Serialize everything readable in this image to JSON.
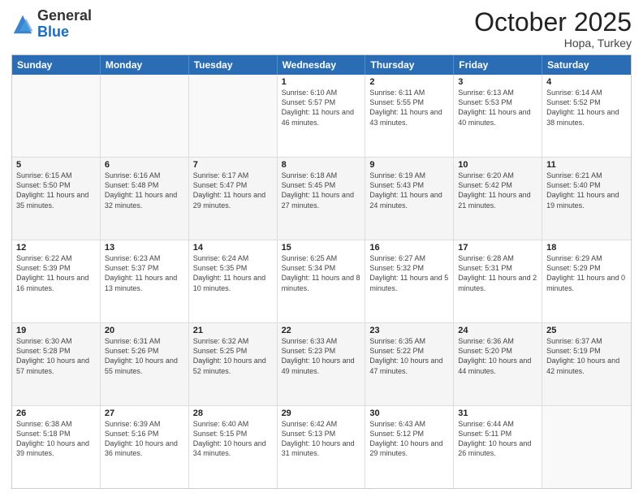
{
  "header": {
    "logo_general": "General",
    "logo_blue": "Blue",
    "month_title": "October 2025",
    "subtitle": "Hopa, Turkey"
  },
  "days_of_week": [
    "Sunday",
    "Monday",
    "Tuesday",
    "Wednesday",
    "Thursday",
    "Friday",
    "Saturday"
  ],
  "rows": [
    {
      "cells": [
        {
          "day": "",
          "info": ""
        },
        {
          "day": "",
          "info": ""
        },
        {
          "day": "",
          "info": ""
        },
        {
          "day": "1",
          "info": "Sunrise: 6:10 AM\nSunset: 5:57 PM\nDaylight: 11 hours and 46 minutes."
        },
        {
          "day": "2",
          "info": "Sunrise: 6:11 AM\nSunset: 5:55 PM\nDaylight: 11 hours and 43 minutes."
        },
        {
          "day": "3",
          "info": "Sunrise: 6:13 AM\nSunset: 5:53 PM\nDaylight: 11 hours and 40 minutes."
        },
        {
          "day": "4",
          "info": "Sunrise: 6:14 AM\nSunset: 5:52 PM\nDaylight: 11 hours and 38 minutes."
        }
      ]
    },
    {
      "cells": [
        {
          "day": "5",
          "info": "Sunrise: 6:15 AM\nSunset: 5:50 PM\nDaylight: 11 hours and 35 minutes."
        },
        {
          "day": "6",
          "info": "Sunrise: 6:16 AM\nSunset: 5:48 PM\nDaylight: 11 hours and 32 minutes."
        },
        {
          "day": "7",
          "info": "Sunrise: 6:17 AM\nSunset: 5:47 PM\nDaylight: 11 hours and 29 minutes."
        },
        {
          "day": "8",
          "info": "Sunrise: 6:18 AM\nSunset: 5:45 PM\nDaylight: 11 hours and 27 minutes."
        },
        {
          "day": "9",
          "info": "Sunrise: 6:19 AM\nSunset: 5:43 PM\nDaylight: 11 hours and 24 minutes."
        },
        {
          "day": "10",
          "info": "Sunrise: 6:20 AM\nSunset: 5:42 PM\nDaylight: 11 hours and 21 minutes."
        },
        {
          "day": "11",
          "info": "Sunrise: 6:21 AM\nSunset: 5:40 PM\nDaylight: 11 hours and 19 minutes."
        }
      ]
    },
    {
      "cells": [
        {
          "day": "12",
          "info": "Sunrise: 6:22 AM\nSunset: 5:39 PM\nDaylight: 11 hours and 16 minutes."
        },
        {
          "day": "13",
          "info": "Sunrise: 6:23 AM\nSunset: 5:37 PM\nDaylight: 11 hours and 13 minutes."
        },
        {
          "day": "14",
          "info": "Sunrise: 6:24 AM\nSunset: 5:35 PM\nDaylight: 11 hours and 10 minutes."
        },
        {
          "day": "15",
          "info": "Sunrise: 6:25 AM\nSunset: 5:34 PM\nDaylight: 11 hours and 8 minutes."
        },
        {
          "day": "16",
          "info": "Sunrise: 6:27 AM\nSunset: 5:32 PM\nDaylight: 11 hours and 5 minutes."
        },
        {
          "day": "17",
          "info": "Sunrise: 6:28 AM\nSunset: 5:31 PM\nDaylight: 11 hours and 2 minutes."
        },
        {
          "day": "18",
          "info": "Sunrise: 6:29 AM\nSunset: 5:29 PM\nDaylight: 11 hours and 0 minutes."
        }
      ]
    },
    {
      "cells": [
        {
          "day": "19",
          "info": "Sunrise: 6:30 AM\nSunset: 5:28 PM\nDaylight: 10 hours and 57 minutes."
        },
        {
          "day": "20",
          "info": "Sunrise: 6:31 AM\nSunset: 5:26 PM\nDaylight: 10 hours and 55 minutes."
        },
        {
          "day": "21",
          "info": "Sunrise: 6:32 AM\nSunset: 5:25 PM\nDaylight: 10 hours and 52 minutes."
        },
        {
          "day": "22",
          "info": "Sunrise: 6:33 AM\nSunset: 5:23 PM\nDaylight: 10 hours and 49 minutes."
        },
        {
          "day": "23",
          "info": "Sunrise: 6:35 AM\nSunset: 5:22 PM\nDaylight: 10 hours and 47 minutes."
        },
        {
          "day": "24",
          "info": "Sunrise: 6:36 AM\nSunset: 5:20 PM\nDaylight: 10 hours and 44 minutes."
        },
        {
          "day": "25",
          "info": "Sunrise: 6:37 AM\nSunset: 5:19 PM\nDaylight: 10 hours and 42 minutes."
        }
      ]
    },
    {
      "cells": [
        {
          "day": "26",
          "info": "Sunrise: 6:38 AM\nSunset: 5:18 PM\nDaylight: 10 hours and 39 minutes."
        },
        {
          "day": "27",
          "info": "Sunrise: 6:39 AM\nSunset: 5:16 PM\nDaylight: 10 hours and 36 minutes."
        },
        {
          "day": "28",
          "info": "Sunrise: 6:40 AM\nSunset: 5:15 PM\nDaylight: 10 hours and 34 minutes."
        },
        {
          "day": "29",
          "info": "Sunrise: 6:42 AM\nSunset: 5:13 PM\nDaylight: 10 hours and 31 minutes."
        },
        {
          "day": "30",
          "info": "Sunrise: 6:43 AM\nSunset: 5:12 PM\nDaylight: 10 hours and 29 minutes."
        },
        {
          "day": "31",
          "info": "Sunrise: 6:44 AM\nSunset: 5:11 PM\nDaylight: 10 hours and 26 minutes."
        },
        {
          "day": "",
          "info": ""
        }
      ]
    }
  ]
}
